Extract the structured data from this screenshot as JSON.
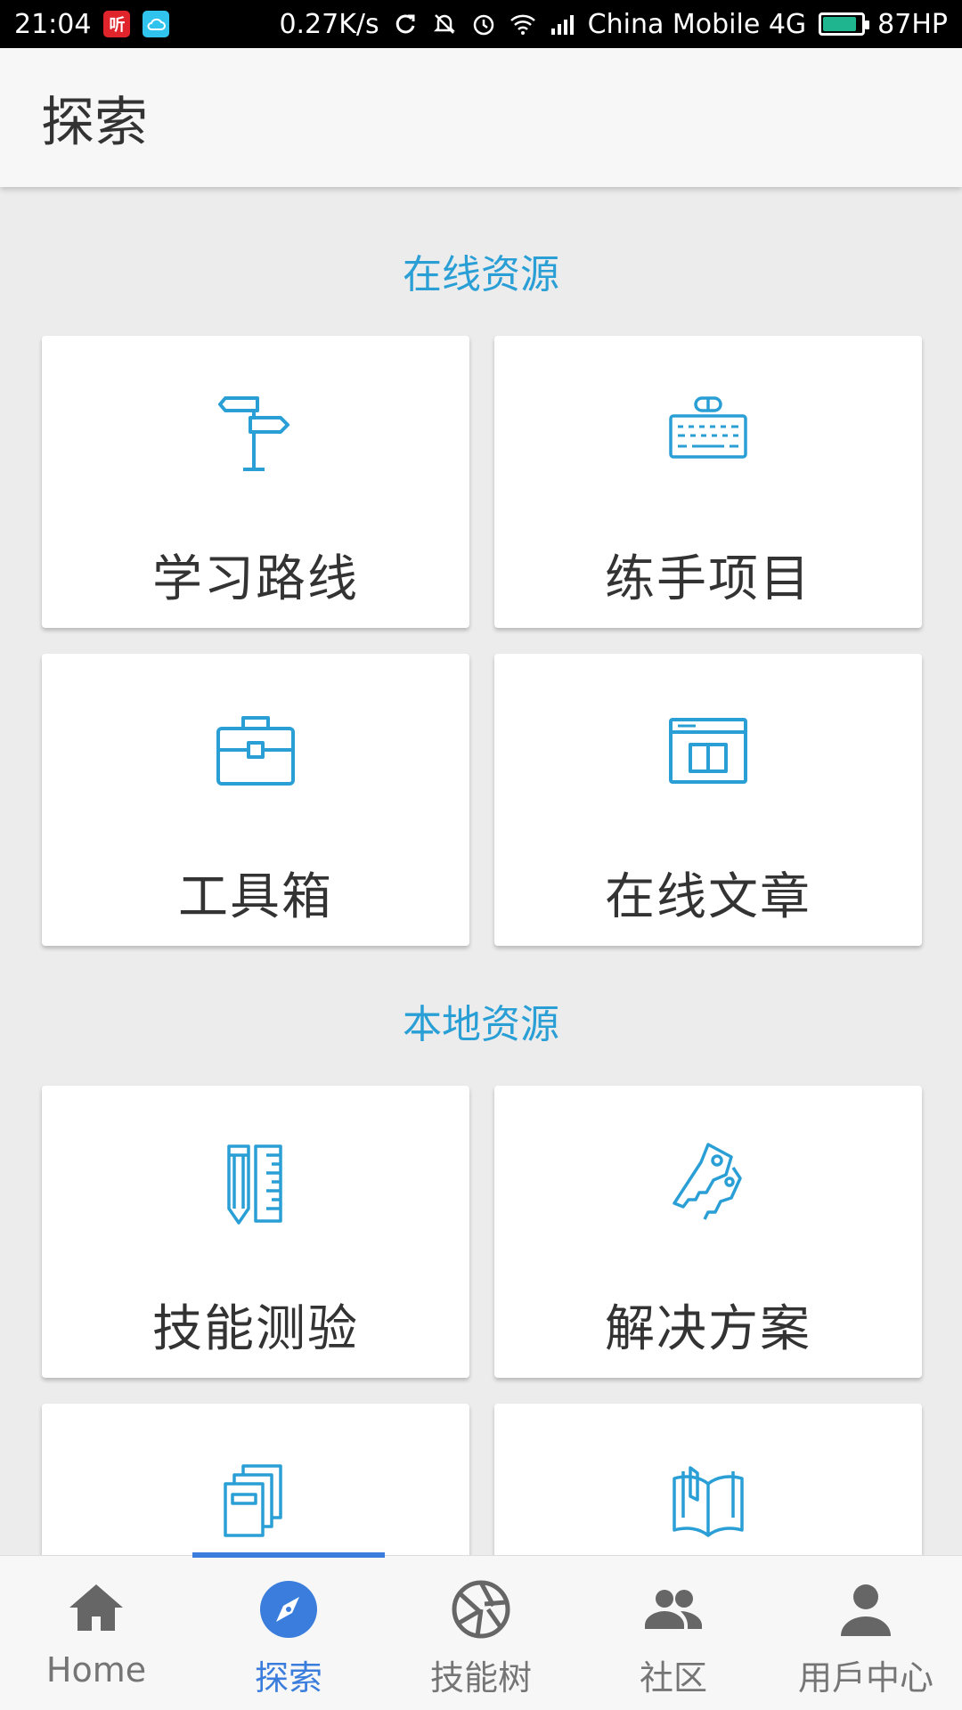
{
  "status_bar": {
    "time": "21:04",
    "speed": "0.27K/s",
    "carrier": "China Mobile 4G",
    "battery": "87HP",
    "battery_level": 0.87,
    "badge_red": "听"
  },
  "appbar": {
    "title": "探索"
  },
  "sections": {
    "online": {
      "title": "在线资源"
    },
    "local": {
      "title": "本地资源"
    }
  },
  "cards": {
    "learning_path": {
      "label": "学习路线",
      "icon": "signpost-icon"
    },
    "practice_projects": {
      "label": "练手项目",
      "icon": "keyboard-icon"
    },
    "toolbox": {
      "label": "工具箱",
      "icon": "briefcase-icon"
    },
    "online_articles": {
      "label": "在线文章",
      "icon": "book-window-icon"
    },
    "skill_test": {
      "label": "技能测验",
      "icon": "pencil-ruler-icon"
    },
    "solutions": {
      "label": "解决方案",
      "icon": "keys-icon"
    },
    "docs": {
      "label": "",
      "icon": "documents-icon"
    },
    "ebooks": {
      "label": "",
      "icon": "open-book-icon"
    }
  },
  "bottom_nav": {
    "items": [
      {
        "label": "Home",
        "icon": "home-icon"
      },
      {
        "label": "探索",
        "icon": "compass-icon"
      },
      {
        "label": "技能树",
        "icon": "aperture-icon"
      },
      {
        "label": "社区",
        "icon": "group-icon"
      },
      {
        "label": "用戶中心",
        "icon": "person-icon"
      }
    ],
    "active_index": 1
  },
  "colors": {
    "accent": "#2a9fd6",
    "nav_active": "#3b7ddd",
    "nav_inactive": "#757575"
  }
}
